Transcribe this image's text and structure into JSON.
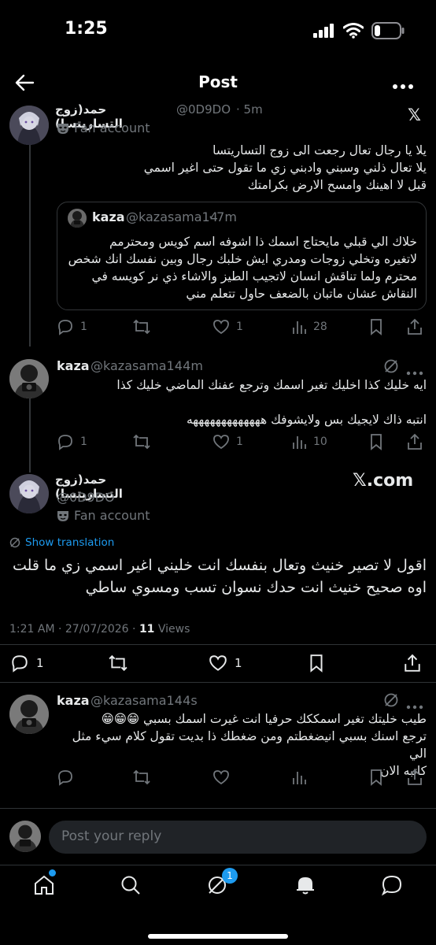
{
  "status_bar": {
    "time": "1:25"
  },
  "header": {
    "title": "Post"
  },
  "parent_tweet": {
    "name": "حمد(زوج التساريتسا)",
    "handle": "@0D9DO",
    "time": "· 5m",
    "badge": "Fan account",
    "lines": [
      "يلا يا رجال تعال رجعت الى زوج التساريتسا",
      "يلا تعال ذلني وسبني وادبني زي ما تقول حتى اغير اسمي",
      "قبل لا اهينك وامسح الارض بكرامتك"
    ],
    "quote": {
      "name": "kaza",
      "handle": "@kazasama14",
      "time": "· 7m",
      "lines": [
        "خلاك الي قبلي مايحتاج اسمك ذا اشوفه اسم كويس ومحترمم",
        "لاتغيره وتخلي زوجات ومدري ايش خلبك رجال وبين نفسك انك شخص",
        "محترم ولما تناقش انسان لاتجيب الطيز والاشاء ذي نر كويسه في",
        "النقاش عشان ماتبان بالضعف حاول تتعلم مني"
      ]
    },
    "stats": {
      "replies": "1",
      "likes": "1",
      "views": "28"
    }
  },
  "reply_one": {
    "name": "kaza",
    "handle": "@kazasama14",
    "time": "· 4m",
    "lines": [
      "ايه خليك كذا اخليك تغير اسمك وترجع عفنك الماضي خليك كذا",
      "انتبه ذاك لايجيك بس ولايشوفك هههههههههههههه"
    ],
    "stats": {
      "replies": "1",
      "likes": "1",
      "views": "10"
    }
  },
  "main_tweet": {
    "name": "حمد(زوج التساريتسا)",
    "handle": "@0D9DO",
    "badge": "Fan account",
    "x_com": "𝕏.com",
    "show_translation": "Show translation",
    "lines": [
      "اقول لا تصير خنيث وتعال بنفسك انت خليني اغير اسمي زي ما قلت",
      "اوه صحيح خنيث انت حدك نسوان تسب ومسوي ساطي"
    ],
    "timestamp": "1:21 AM · 27/07/2026 · ",
    "views_count": "11",
    "views_label": " Views",
    "stats": {
      "replies": "1",
      "likes": "1"
    }
  },
  "reply_two": {
    "name": "kaza",
    "handle": "@kazasama14",
    "time": "· 4s",
    "lines": [
      "طيب خليتك تغير اسمككك حرفيا انت غيرت اسمك بسبي 😁😁😁",
      "ترجع اسنك بسبي انيضغطتم ومن ضغطك ذا بديت تقول كلام سيء مثل الي",
      "كاتبه الان"
    ]
  },
  "reply_bar": {
    "placeholder": "Post your reply"
  },
  "bottom_nav": {
    "notifications_badge": "1"
  },
  "colors": {
    "background": "#000000",
    "accent": "#1d9bf0",
    "text": "#e7e9ea",
    "muted": "#71767b",
    "border": "#2f3336"
  }
}
